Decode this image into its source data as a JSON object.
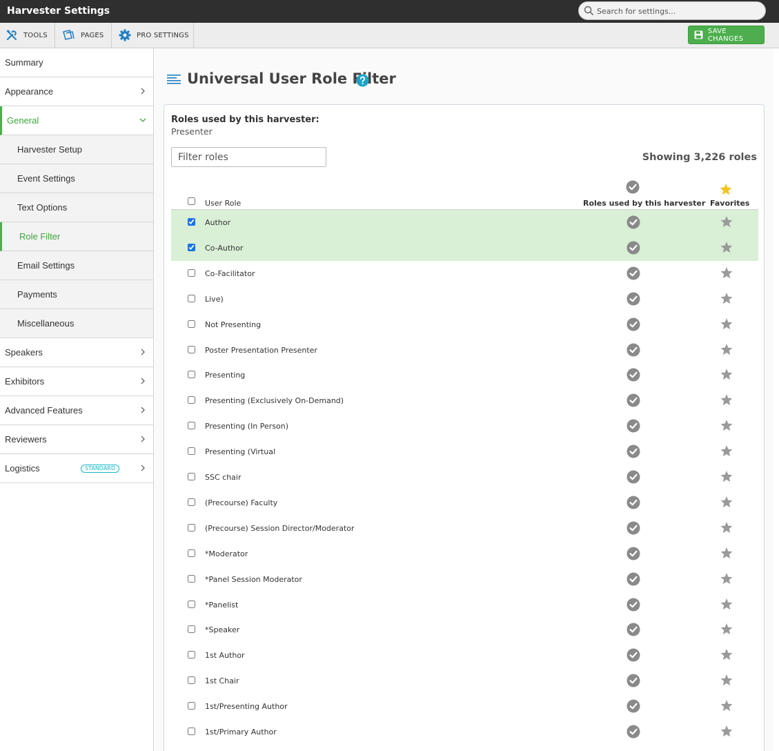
{
  "window": {
    "title": "Harvester Settings"
  },
  "search": {
    "placeholder": "Search for settings..."
  },
  "toolbar": {
    "tools_label": "TOOLS",
    "pages_label": "PAGES",
    "pro_settings_label": "PRO SETTINGS",
    "save_label": "SAVE CHANGES"
  },
  "sidebar": {
    "items": [
      {
        "label": "Summary"
      },
      {
        "label": "Appearance"
      },
      {
        "label": "General"
      },
      {
        "label": "Harvester Setup"
      },
      {
        "label": "Event Settings"
      },
      {
        "label": "Text Options"
      },
      {
        "label": "Role Filter"
      },
      {
        "label": "Email Settings"
      },
      {
        "label": "Payments"
      },
      {
        "label": "Miscellaneous"
      },
      {
        "label": "Speakers"
      },
      {
        "label": "Exhibitors"
      },
      {
        "label": "Advanced Features"
      },
      {
        "label": "Reviewers"
      },
      {
        "label": "Logistics",
        "badge": "STANDARD"
      }
    ]
  },
  "main": {
    "title": "Universal User Role Filter",
    "roles_used_label": "Roles used by this harvester:",
    "roles_used_value": "Presenter",
    "filter_placeholder": "Filter roles",
    "showing_text": "Showing 3,226 roles",
    "table": {
      "col_role": "User Role",
      "col_used": "Roles used by this harvester",
      "col_fav": "Favorites",
      "rows": [
        {
          "name": "Author",
          "checked": true
        },
        {
          "name": "Co-Author",
          "checked": true
        },
        {
          "name": "Co-Facilitator",
          "checked": false
        },
        {
          "name": "Live)",
          "checked": false
        },
        {
          "name": "Not Presenting",
          "checked": false
        },
        {
          "name": "Poster Presentation Presenter",
          "checked": false
        },
        {
          "name": "Presenting",
          "checked": false
        },
        {
          "name": "Presenting (Exclusively On-Demand)",
          "checked": false
        },
        {
          "name": "Presenting (In Person)",
          "checked": false
        },
        {
          "name": "Presenting (Virtual",
          "checked": false
        },
        {
          "name": "SSC chair",
          "checked": false
        },
        {
          "name": "(Precourse) Faculty",
          "checked": false
        },
        {
          "name": "(Precourse) Session Director/Moderator",
          "checked": false
        },
        {
          "name": "*Moderator",
          "checked": false
        },
        {
          "name": "*Panel Session Moderator",
          "checked": false
        },
        {
          "name": "*Panelist",
          "checked": false
        },
        {
          "name": "*Speaker",
          "checked": false
        },
        {
          "name": "1st Author",
          "checked": false
        },
        {
          "name": "1st Chair",
          "checked": false
        },
        {
          "name": "1st/Presenting Author",
          "checked": false
        },
        {
          "name": "1st/Primary Author",
          "checked": false
        }
      ]
    }
  },
  "colors": {
    "accent_green": "#4cae4c",
    "selected_row": "#d9efd6",
    "titlebar": "#2f2f2f",
    "badge_teal": "#1bb5c9",
    "help_teal": "#1aa3c6",
    "star_gold": "#f2c417"
  }
}
